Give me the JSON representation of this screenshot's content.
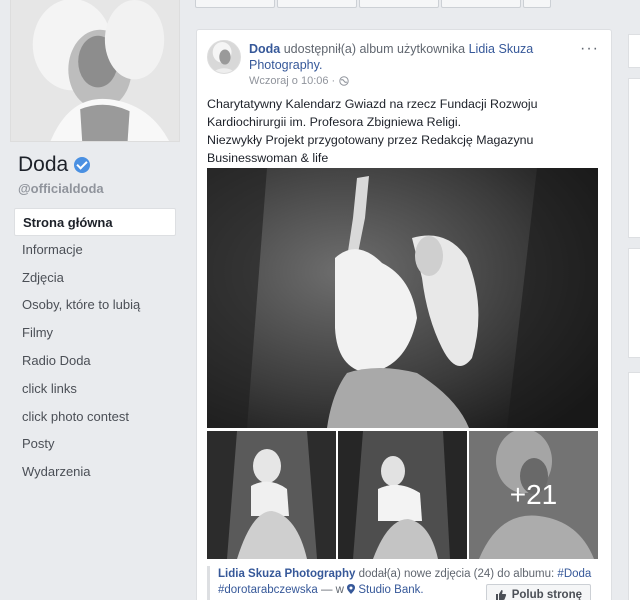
{
  "profile": {
    "name": "Doda",
    "handle": "@officialdoda"
  },
  "nav": {
    "items": [
      {
        "label": "Strona główna"
      },
      {
        "label": "Informacje"
      },
      {
        "label": "Zdjęcia"
      },
      {
        "label": "Osoby, które to lubią"
      },
      {
        "label": "Filmy"
      },
      {
        "label": "Radio Doda"
      },
      {
        "label": "click links"
      },
      {
        "label": "click photo contest"
      },
      {
        "label": "Posty"
      },
      {
        "label": "Wydarzenia"
      }
    ]
  },
  "post": {
    "author": "Doda",
    "verb": "udostępnił(a) album",
    "verb2": "użytkownika",
    "shared_from": "Lidia Skuza Photography.",
    "timestamp": "Wczoraj o 10:06 ·",
    "more": "···",
    "text_line1": "Charytatywny Kalendarz Gwiazd na rzecz Fundacji Rozwoju",
    "text_line2": "Kardiochirurgii im. Profesora Zbigniewa Religi.",
    "text_line3": "Niezwykły Projekt przygotowany przez Redakcję Magazynu",
    "text_line4": "Businesswoman & life",
    "more_photos": "+21",
    "shared": {
      "author": "Lidia Skuza Photography",
      "action": "dodał(a) nowe zdjęcia (24) do albumu:",
      "album": "#Doda",
      "tag": "#dorotarabczewska",
      "sep": "— w",
      "place": "Studio Bank."
    },
    "like_page_button": "Polub stronę"
  },
  "colors": {
    "link": "#365899",
    "verified": "#4a90e2",
    "background": "#e9ebee"
  }
}
